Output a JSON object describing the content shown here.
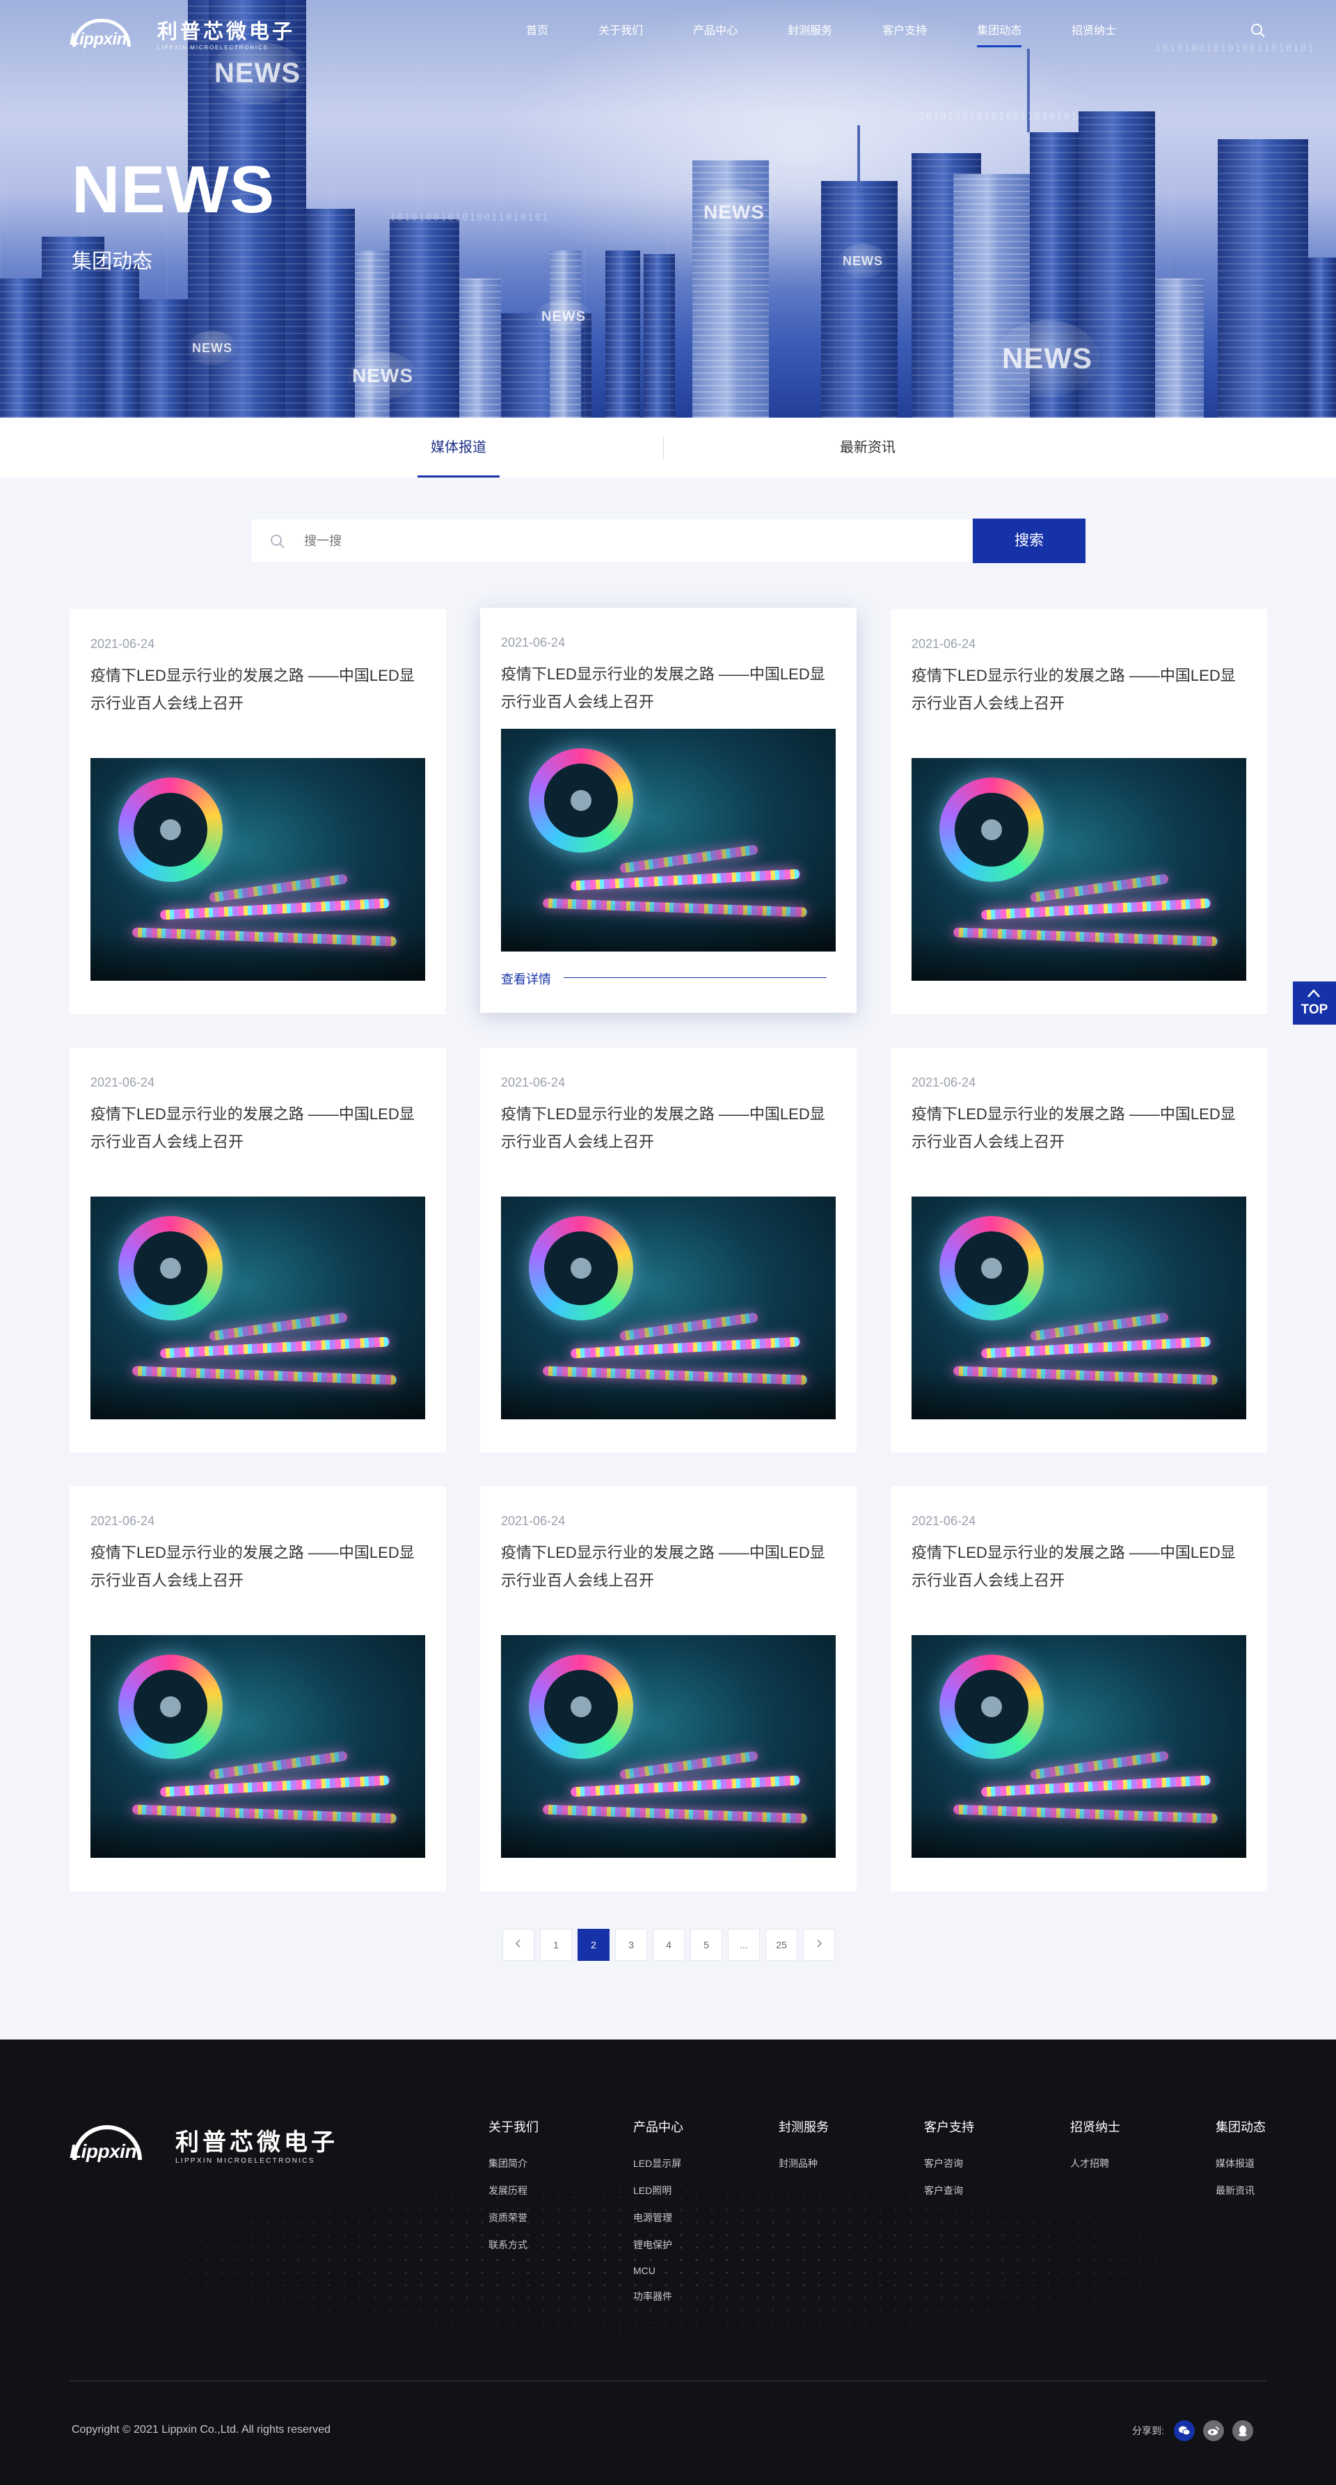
{
  "brand": {
    "wordmark": "Lippxin",
    "cn_name": "利普芯微电子",
    "en_name": "LIPPXIN MICROELECTRONICS"
  },
  "nav": {
    "items": [
      "首页",
      "关于我们",
      "产品中心",
      "封测服务",
      "客户支持",
      "集团动态",
      "招贤纳士"
    ],
    "active": "集团动态",
    "search_icon": "search-icon"
  },
  "hero": {
    "title": "NEWS",
    "subtitle": "集团动态",
    "badge_text": "NEWS",
    "binary_text": "1010100101010011010101"
  },
  "tabs": {
    "items": [
      "媒体报道",
      "最新资讯"
    ],
    "active": "媒体报道"
  },
  "search": {
    "placeholder": "搜一搜",
    "button": "搜索"
  },
  "cards": [
    {
      "date": "2021-06-24",
      "title": "疫情下LED显示行业的发展之路 ——中国LED显示行业百人会线上召开"
    },
    {
      "date": "2021-06-24",
      "title": "疫情下LED显示行业的发展之路 ——中国LED显示行业百人会线上召开",
      "more": "查看详情"
    },
    {
      "date": "2021-06-24",
      "title": "疫情下LED显示行业的发展之路 ——中国LED显示行业百人会线上召开"
    },
    {
      "date": "2021-06-24",
      "title": "疫情下LED显示行业的发展之路 ——中国LED显示行业百人会线上召开"
    },
    {
      "date": "2021-06-24",
      "title": "疫情下LED显示行业的发展之路 ——中国LED显示行业百人会线上召开"
    },
    {
      "date": "2021-06-24",
      "title": "疫情下LED显示行业的发展之路 ——中国LED显示行业百人会线上召开"
    },
    {
      "date": "2021-06-24",
      "title": "疫情下LED显示行业的发展之路 ——中国LED显示行业百人会线上召开"
    },
    {
      "date": "2021-06-24",
      "title": "疫情下LED显示行业的发展之路 ——中国LED显示行业百人会线上召开"
    },
    {
      "date": "2021-06-24",
      "title": "疫情下LED显示行业的发展之路 ——中国LED显示行业百人会线上召开"
    }
  ],
  "pagination": {
    "pages": [
      "1",
      "2",
      "3",
      "4",
      "5",
      "...",
      "25"
    ],
    "current": "2",
    "prev_icon": "chevron-left-icon",
    "next_icon": "chevron-right-icon"
  },
  "back_to_top": {
    "label": "TOP"
  },
  "footer": {
    "columns": [
      {
        "heading": "关于我们",
        "items": [
          "集团简介",
          "发展历程",
          "资质荣誉",
          "联系方式"
        ]
      },
      {
        "heading": "产品中心",
        "items": [
          "LED显示屏",
          "LED照明",
          "电源管理",
          "锂电保护",
          "MCU",
          "功率器件"
        ]
      },
      {
        "heading": "封测服务",
        "items": [
          "封测品种"
        ]
      },
      {
        "heading": "客户支持",
        "items": [
          "客户咨询",
          "客户查询"
        ]
      },
      {
        "heading": "招贤纳士",
        "items": [
          "人才招聘"
        ]
      },
      {
        "heading": "集团动态",
        "items": [
          "媒体报道",
          "最新资讯"
        ]
      }
    ],
    "copyright": "Copyright © 2021 Lippxin  Co.,Ltd. All rights reserved",
    "share_label": "分享到:",
    "share_icons": [
      "wechat-icon",
      "weibo-icon",
      "qq-icon"
    ]
  },
  "colors": {
    "brand_blue": "#1532a8",
    "footer_bg": "#111216",
    "page_bg": "#f3f5fb"
  }
}
